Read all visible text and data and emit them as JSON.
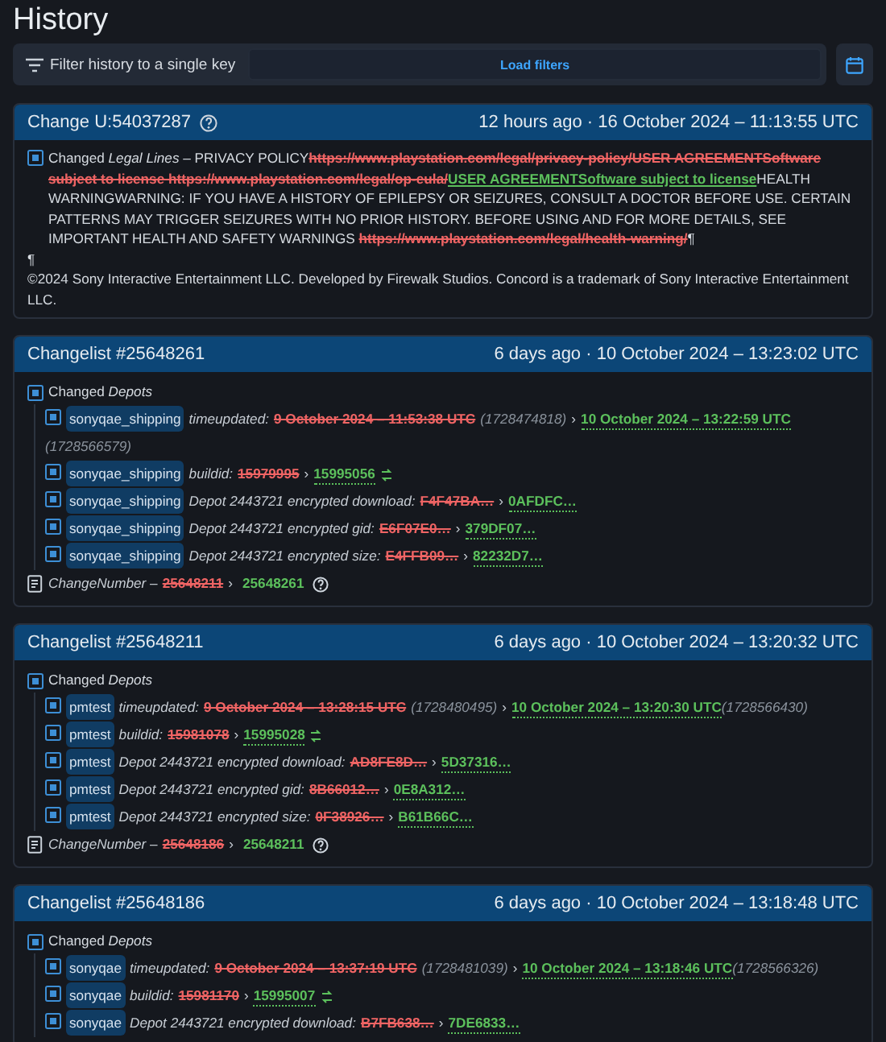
{
  "title": "History",
  "filter": {
    "label": "Filter history to a single key",
    "button": "Load filters"
  },
  "cards": [
    {
      "kind": "text",
      "title": "Change U:54037287",
      "help": true,
      "when": "12 hours ago · 16 October 2024 – 11:13:55 UTC",
      "paragraphs": [
        [
          {
            "kind": "plain",
            "text": "Changed *Legal Lines* – PRIVACY POLICY"
          },
          {
            "kind": "removed",
            "text": "https://www.playstation.com/legal/privacy-policy/USER AGREEMENTSoftware subject to license https://www.playstation.com/legal/op-eula/"
          },
          {
            "kind": "added",
            "text": "USER AGREEMENTSoftware subject to license"
          },
          {
            "kind": "plain",
            "text": "HEALTH WARNINGWARNING: IF YOU HAVE A HISTORY OF EPILEPSY OR SEIZURES, CONSULT A DOCTOR BEFORE USE. CERTAIN PATTERNS MAY TRIGGER SEIZURES WITH NO PRIOR HISTORY. BEFORE USING AND FOR MORE DETAILS, SEE IMPORTANT HEALTH AND SAFETY WARNINGS "
          },
          {
            "kind": "removed",
            "text": "https://www.playstation.com/legal/health-warning/"
          },
          {
            "kind": "plain",
            "text": "¶"
          }
        ],
        [
          {
            "kind": "plain",
            "text": "¶"
          }
        ],
        [
          {
            "kind": "plain",
            "text": "©2024 Sony Interactive Entertainment LLC. Developed by Firewalk Studios. Concord is a trademark of Sony Interactive Entertainment LLC."
          }
        ]
      ]
    },
    {
      "kind": "changelist",
      "title": "Changelist #25648261",
      "help": false,
      "when": "6 days ago · 10 October 2024 – 13:23:02 UTC",
      "section": "Changed *Depots*",
      "rows": [
        {
          "tag": "sonyqae_shipping",
          "key": "timeupdated:",
          "old": "9 October 2024 – 11:53:38 UTC",
          "old_note": "(1728474818)",
          "sep": "›",
          "new": "10 October 2024 – 13:22:59 UTC",
          "new_note": "(1728566579)",
          "diff_icon": false
        },
        {
          "tag": "sonyqae_shipping",
          "key": "buildid:",
          "old": "15979995",
          "sep": "›",
          "new": "15995056",
          "diff_icon": true
        },
        {
          "tag": "sonyqae_shipping",
          "key": "Depot 2443721 encrypted download:",
          "old": "F4F47BA…",
          "sep": "›",
          "new": "0AFDFC…",
          "diff_icon": false
        },
        {
          "tag": "sonyqae_shipping",
          "key": "Depot 2443721 encrypted gid:",
          "old": "E6F07E0…",
          "sep": "›",
          "new": "379DF07…",
          "diff_icon": false
        },
        {
          "tag": "sonyqae_shipping",
          "key": "Depot 2443721 encrypted size:",
          "old": "E4FFB09…",
          "sep": "›",
          "new": "82232D7…",
          "diff_icon": false
        }
      ],
      "footer": {
        "key": "*ChangeNumber* –",
        "old": "25648211",
        "sep": "›",
        "new": "25648261"
      }
    },
    {
      "kind": "changelist",
      "title": "Changelist #25648211",
      "help": false,
      "when": "6 days ago · 10 October 2024 – 13:20:32 UTC",
      "section": "Changed *Depots*",
      "rows": [
        {
          "tag": "pmtest",
          "key": "timeupdated:",
          "old": "9 October 2024 – 13:28:15 UTC",
          "old_note": "(1728480495)",
          "sep": "›",
          "new": "10 October 2024 – 13:20:30 UTC",
          "new_note": "(1728566430)",
          "diff_icon": false
        },
        {
          "tag": "pmtest",
          "key": "buildid:",
          "old": "15981078",
          "sep": "›",
          "new": "15995028",
          "diff_icon": true
        },
        {
          "tag": "pmtest",
          "key": "Depot 2443721 encrypted download:",
          "old": "AD8FE8D…",
          "sep": "›",
          "new": "5D37316…",
          "diff_icon": false
        },
        {
          "tag": "pmtest",
          "key": "Depot 2443721 encrypted gid:",
          "old": "8B66012…",
          "sep": "›",
          "new": "0E8A312…",
          "diff_icon": false
        },
        {
          "tag": "pmtest",
          "key": "Depot 2443721 encrypted size:",
          "old": "0F38926…",
          "sep": "›",
          "new": "B61B66C…",
          "diff_icon": false
        }
      ],
      "footer": {
        "key": "*ChangeNumber* –",
        "old": "25648186",
        "sep": "›",
        "new": "25648211"
      }
    },
    {
      "kind": "changelist",
      "title": "Changelist #25648186",
      "help": false,
      "when": "6 days ago · 10 October 2024 – 13:18:48 UTC",
      "section": "Changed *Depots*",
      "rows": [
        {
          "tag": "sonyqae",
          "key": "timeupdated:",
          "old": "9 October 2024 – 13:37:19 UTC",
          "old_note": "(1728481039)",
          "sep": "›",
          "new": "10 October 2024 – 13:18:46 UTC",
          "new_note": "(1728566326)",
          "diff_icon": false
        },
        {
          "tag": "sonyqae",
          "key": "buildid:",
          "old": "15981170",
          "sep": "›",
          "new": "15995007",
          "diff_icon": true
        },
        {
          "tag": "sonyqae",
          "key": "Depot 2443721 encrypted download:",
          "old": "B7FB638…",
          "sep": "›",
          "new": "7DE6833…",
          "diff_icon": false
        }
      ]
    }
  ]
}
